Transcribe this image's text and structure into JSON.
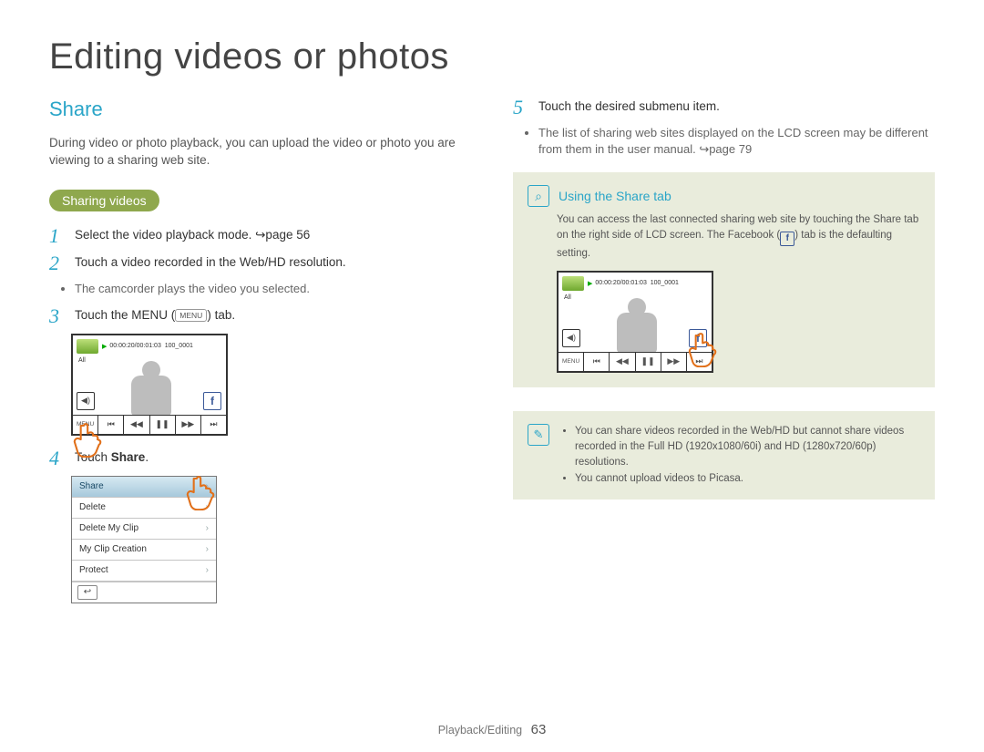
{
  "title": "Editing videos or photos",
  "section": "Share",
  "intro": "During video or photo playback, you can upload the video or photo you are viewing to a sharing web site.",
  "pill": "Sharing videos",
  "steps": {
    "s1": {
      "n": "1",
      "text_a": "Select the video playback mode. ",
      "ref": "↪page 56"
    },
    "s2": {
      "n": "2",
      "text": "Touch a video recorded in the Web/HD resolution.",
      "bullet": "The camcorder plays the video you selected."
    },
    "s3": {
      "n": "3",
      "text_a": "Touch the MENU (",
      "menu_key": "MENU",
      "text_b": ") tab."
    },
    "s4": {
      "n": "4",
      "text_a": "Touch ",
      "bold": "Share",
      "text_b": "."
    },
    "s5": {
      "n": "5",
      "text": "Touch the desired submenu item.",
      "bullet_a": "The list of sharing web sites displayed on the LCD screen may be different from them in the user manual. ",
      "bullet_ref": "↪page 79"
    }
  },
  "lcd": {
    "timecode": "00:00:20/00:01:03",
    "clip": "100_0001",
    "all": "All",
    "menu": "MENU",
    "vol": "◀)",
    "controls": [
      "⏮",
      "◀◀",
      "❚❚",
      "▶▶",
      "⏭"
    ]
  },
  "menu_list": {
    "items": [
      {
        "label": "Share",
        "selected": true
      },
      {
        "label": "Delete"
      },
      {
        "label": "Delete My Clip"
      },
      {
        "label": "My Clip Creation"
      },
      {
        "label": "Protect"
      }
    ],
    "back": "↩"
  },
  "info": {
    "title": "Using the Share tab",
    "body_a": "You can access the last connected sharing web site by touching the Share tab on the right side of LCD screen. The Facebook (",
    "body_b": ") tab is the defaulting setting.",
    "icon": "⌕"
  },
  "note": {
    "icon": "✎",
    "items": [
      "You can share videos recorded in the Web/HD but cannot share videos recorded in the Full HD (1920x1080/60i) and HD (1280x720/60p) resolutions.",
      "You cannot upload videos to Picasa."
    ]
  },
  "footer": {
    "section": "Playback/Editing",
    "page": "63"
  }
}
